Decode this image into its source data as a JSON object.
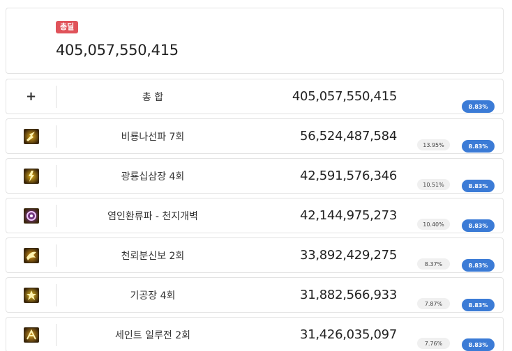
{
  "summary": {
    "badge": "총딜",
    "total": "405,057,550,415"
  },
  "total_row": {
    "icon": "plus-icon",
    "symbol": "+",
    "name": "총 합",
    "value": "405,057,550,415",
    "share": "8.83%"
  },
  "skills": [
    {
      "icon": "dragon-strike-icon",
      "name": "비룡나선파 7회",
      "value": "56,524,487,584",
      "pct": "13.95%",
      "share": "8.83%",
      "color": "#d9a51c"
    },
    {
      "icon": "lightning-fist-icon",
      "name": "광룡십삼장 4회",
      "value": "42,591,576,346",
      "pct": "10.51%",
      "share": "8.83%",
      "color": "#e0b21d"
    },
    {
      "icon": "purple-vortex-icon",
      "name": "염인환류파 - 천지개벽",
      "value": "42,144,975,273",
      "pct": "10.40%",
      "share": "8.83%",
      "color": "#8a3fb0"
    },
    {
      "icon": "swift-kick-icon",
      "name": "천뢰분신보 2회",
      "value": "33,892,429,275",
      "pct": "8.37%",
      "share": "8.83%",
      "color": "#d99a1a"
    },
    {
      "icon": "ki-palm-icon",
      "name": "기공장 4회",
      "value": "31,882,566,933",
      "pct": "7.87%",
      "share": "8.83%",
      "color": "#e6c02a"
    },
    {
      "icon": "saint-rush-icon",
      "name": "세인트 일루전 2회",
      "value": "31,426,035,097",
      "pct": "7.76%",
      "share": "8.83%",
      "color": "#d29b22"
    }
  ]
}
